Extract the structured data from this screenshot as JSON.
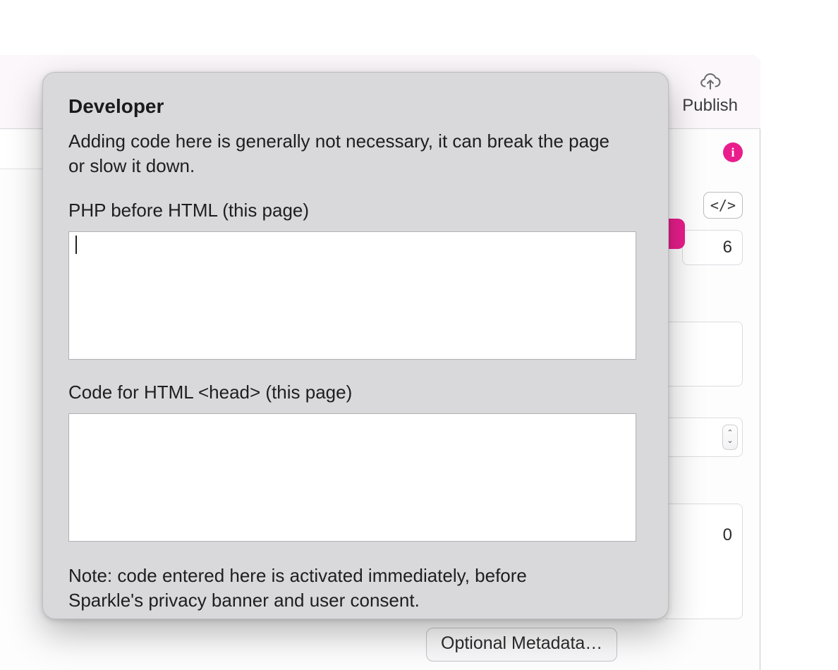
{
  "toolbar": {
    "publish_label": "Publish"
  },
  "right_panel": {
    "info_badge": "i",
    "code_chip": "</>",
    "value_a": "6",
    "value_b": "0"
  },
  "bottom": {
    "optional_metadata_button": "Optional Metadata…"
  },
  "popover": {
    "title": "Developer",
    "description": "Adding code here is generally not necessary, it can break the page or slow it down.",
    "php_label": "PHP before HTML (this page)",
    "php_value": "",
    "head_label": "Code for HTML <head> (this page)",
    "head_value": "",
    "note": "Note: code entered here is activated immediately, before Sparkle's privacy banner and user consent."
  }
}
